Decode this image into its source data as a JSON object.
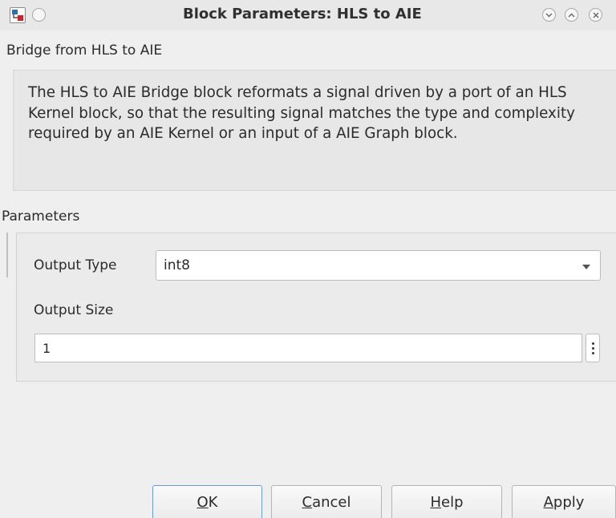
{
  "window": {
    "title": "Block Parameters: HLS to AIE"
  },
  "header": {
    "label": "Bridge from HLS to AIE"
  },
  "description": {
    "text": "The HLS to AIE Bridge block reformats a signal driven by a port of an HLS Kernel block, so that the resulting signal matches the type and complexity required by an AIE Kernel or an input of a AIE Graph block."
  },
  "parameters": {
    "label": "Parameters",
    "output_type": {
      "label": "Output Type",
      "value": "int8"
    },
    "output_size": {
      "label": "Output Size",
      "value": "1"
    }
  },
  "buttons": {
    "ok": {
      "mnemonic": "O",
      "rest": "K"
    },
    "cancel": {
      "mnemonic": "C",
      "rest": "ancel"
    },
    "help": {
      "mnemonic": "H",
      "rest": "elp"
    },
    "apply": {
      "mnemonic": "A",
      "rest": "pply"
    }
  },
  "colors": {
    "primary_button_border": "#6e9ad2",
    "icon_red": "#c8242b",
    "icon_blue": "#2a6fb8"
  }
}
